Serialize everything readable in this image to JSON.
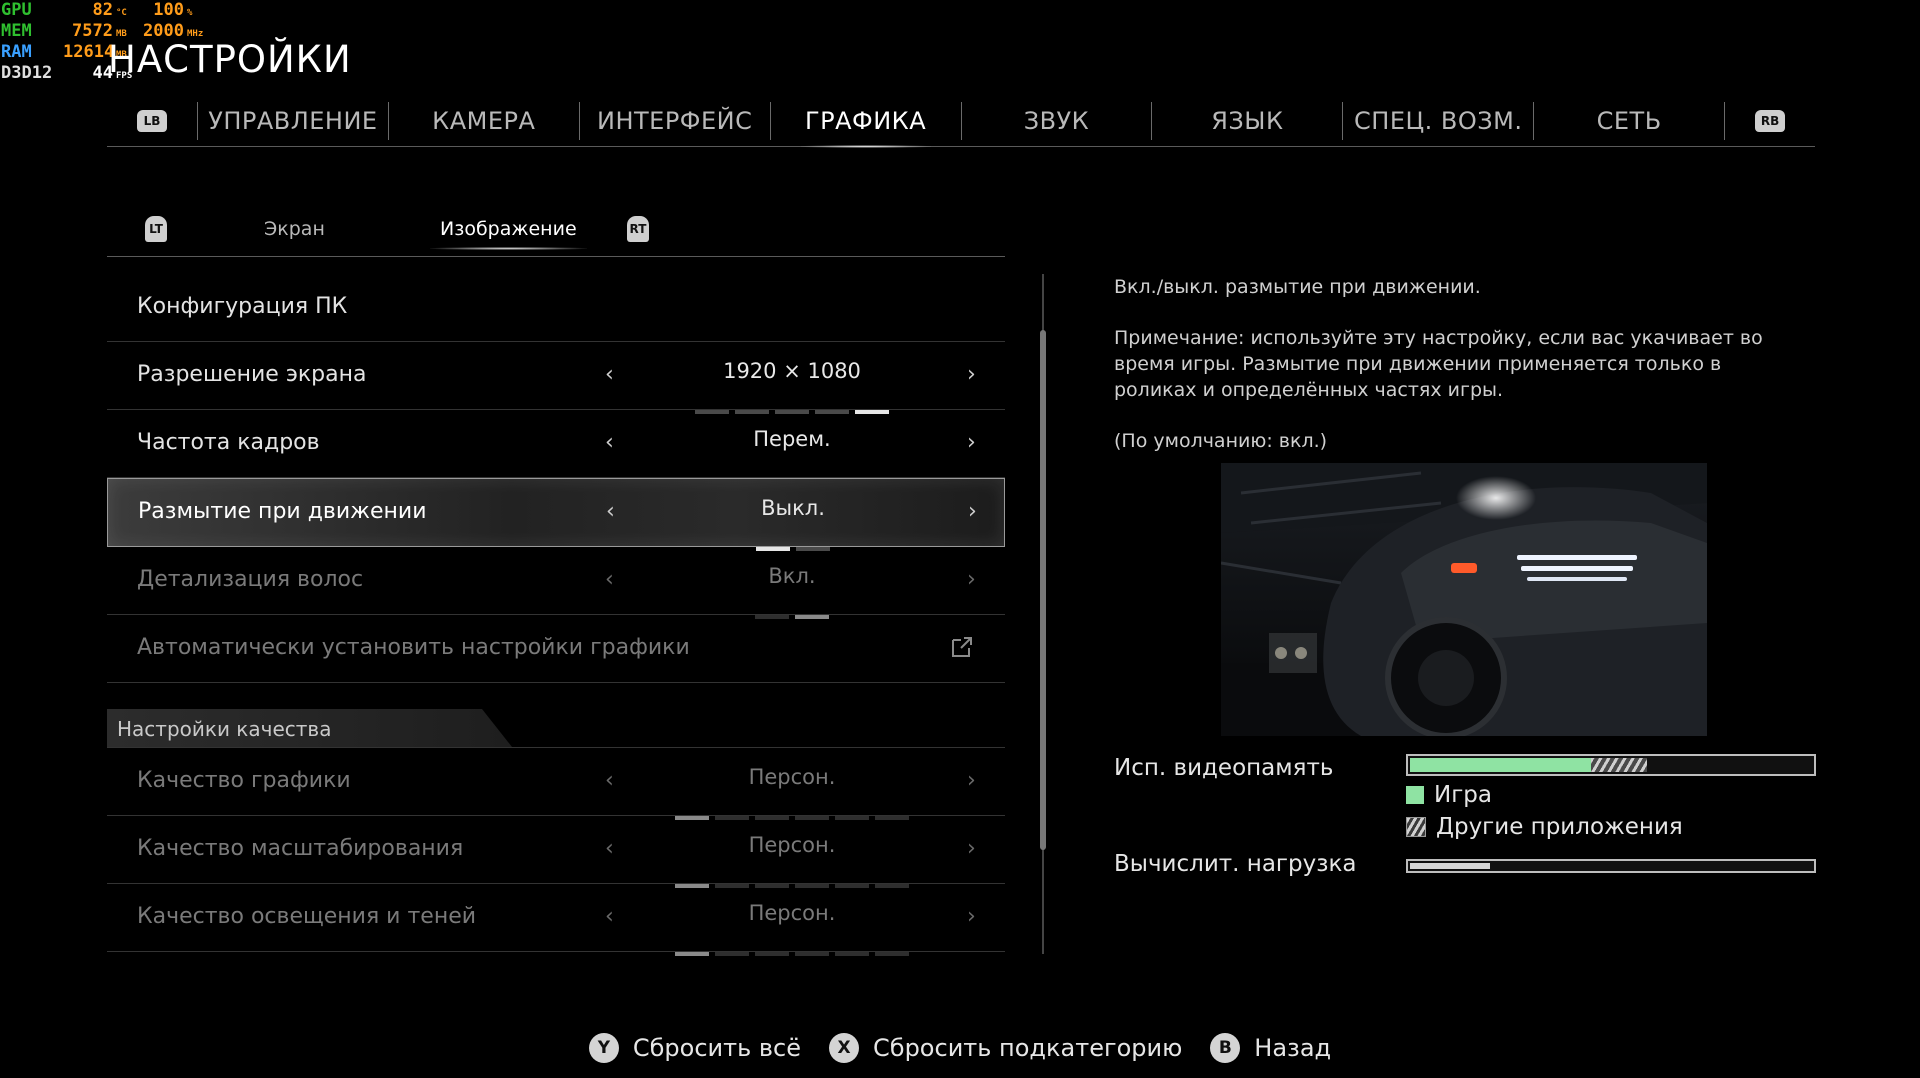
{
  "overlay": {
    "rows": [
      {
        "label": "GPU",
        "v1": "82",
        "u1": "°C",
        "v2": "100",
        "u2": "%"
      },
      {
        "label": "MEM",
        "v1": "7572",
        "u1": "MB",
        "v2": "2000",
        "u2": "MHz"
      },
      {
        "label": "RAM",
        "v1": "12614",
        "u1": "MB",
        "v2": "",
        "u2": ""
      },
      {
        "label": "D3D12",
        "v1": "44",
        "u1": "FPS",
        "v2": "",
        "u2": ""
      }
    ]
  },
  "page": {
    "title": "НАСТРОЙКИ"
  },
  "top_tabs": {
    "left_bumper": "LB",
    "right_bumper": "RB",
    "items": [
      "УПРАВЛЕНИЕ",
      "КАМЕРА",
      "ИНТЕРФЕЙС",
      "ГРАФИКА",
      "ЗВУК",
      "ЯЗЫК",
      "СПЕЦ. ВОЗМ.",
      "СЕТЬ"
    ],
    "active": "ГРАФИКА"
  },
  "sub_tabs": {
    "left_trigger": "LT",
    "right_trigger": "RT",
    "items": [
      "Экран",
      "Изображение"
    ],
    "active": "Изображение"
  },
  "settings": {
    "rows": [
      {
        "label": "Конфигурация ПК",
        "value": ""
      },
      {
        "label": "Разрешение экрана",
        "value": "1920 × 1080",
        "segments": 5,
        "active_segment": 5
      },
      {
        "label": "Частота кадров",
        "value": "Перем.",
        "segments": 4,
        "active_segment": 4
      },
      {
        "label": "Размытие при движении",
        "value": "Выкл.",
        "segments": 2,
        "active_segment": 1,
        "selected": true
      },
      {
        "label": "Детализация волос",
        "value": "Вкл.",
        "segments": 2,
        "active_segment": 2,
        "disabled": true
      },
      {
        "label": "Автоматически установить настройки графики",
        "icon": "external-link-icon",
        "disabled": true
      }
    ],
    "quality_section_title": "Настройки качества",
    "quality_rows": [
      {
        "label": "Качество графики",
        "value": "Персон.",
        "segments": 6,
        "active_segment": 1
      },
      {
        "label": "Качество масштабирования",
        "value": "Персон.",
        "segments": 6,
        "active_segment": 1
      },
      {
        "label": "Качество освещения и теней",
        "value": "Персон.",
        "segments": 6,
        "active_segment": 1
      }
    ]
  },
  "description": {
    "line1": "Вкл./выкл. размытие при движении.",
    "note": "Примечание: используйте эту настройку, если вас укачивает во время игры. Размытие при движении применяется только в роликах и определённых частях игры.",
    "default": "(По умолчанию: вкл.)"
  },
  "vram": {
    "label": "Исп. видеопамять",
    "game_fraction": 0.45,
    "other_fraction": 0.14,
    "legend_game": "Игра",
    "legend_other": "Другие приложения",
    "game_color": "#8fe3a3"
  },
  "compute": {
    "label": "Вычислит. нагрузка",
    "fraction": 0.2
  },
  "footer": {
    "items": [
      {
        "button": "Y",
        "label": "Сбросить всё"
      },
      {
        "button": "X",
        "label": "Сбросить подкатегорию"
      },
      {
        "button": "B",
        "label": "Назад"
      }
    ]
  }
}
